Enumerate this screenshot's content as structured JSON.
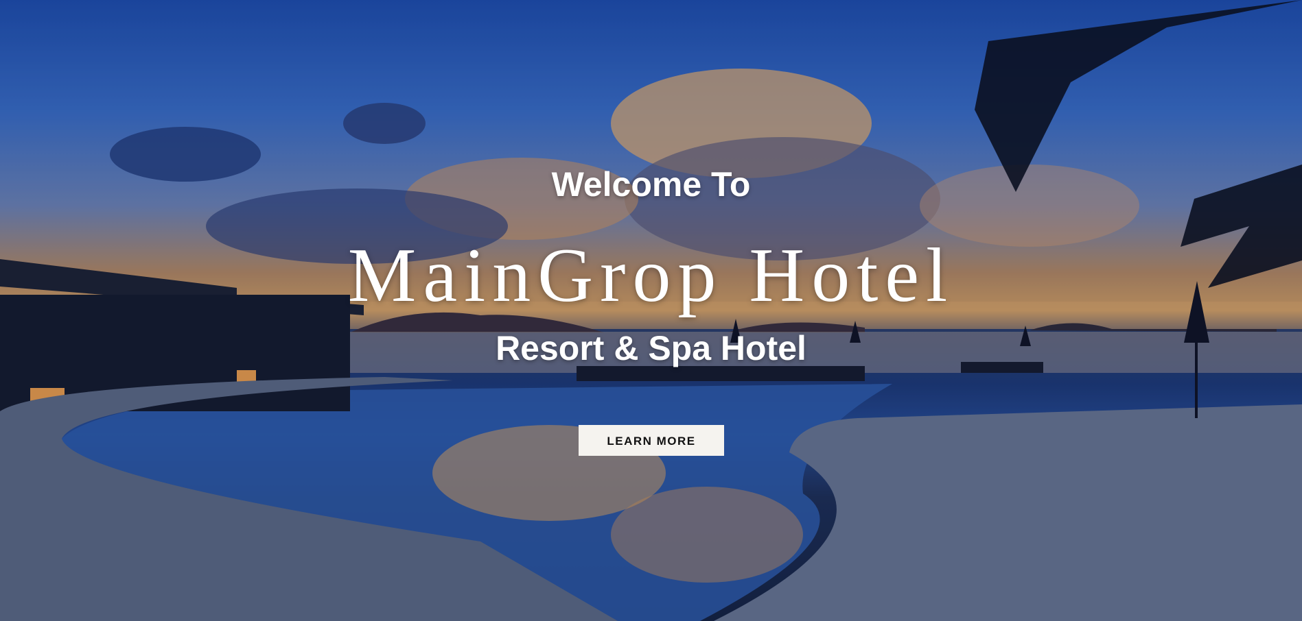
{
  "hero": {
    "welcome": "Welcome To",
    "hotel_name": "MainGrop Hotel",
    "tagline": "Resort & Spa Hotel",
    "cta_label": "LEARN MORE"
  },
  "colors": {
    "sky_top": "#1e4fb0",
    "sunset_glow": "#d8a362",
    "water": "#274f9a",
    "deck": "#6f7c96",
    "button_bg": "#f5f3ef",
    "button_text": "#111111"
  }
}
